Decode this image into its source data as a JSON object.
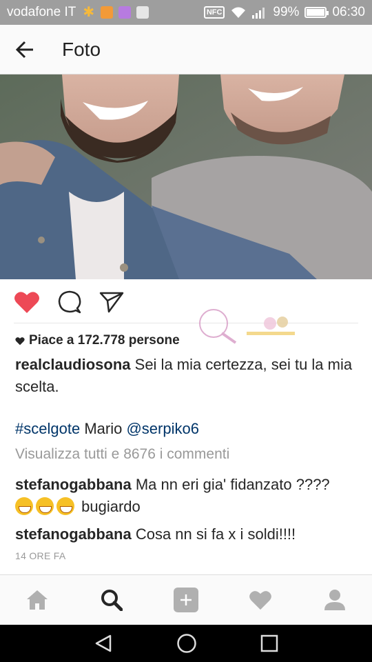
{
  "status_bar": {
    "carrier": "vodafone IT",
    "nfc": "NFC",
    "battery": "99%",
    "battery_level": 0.99,
    "time": "06:30"
  },
  "header": {
    "title": "Foto",
    "back_icon": "arrow-left-icon"
  },
  "post": {
    "likes_text": "Piace a 172.778 persone",
    "author": "realclaudiosona",
    "caption": "Sei la mia certezza, sei tu la mia scelta.",
    "hashtag": "#scelgote",
    "tag_text": "Mario",
    "mention": "@serpiko6",
    "view_all": "Visualizza tutti e 8676 i commenti",
    "comments": [
      {
        "user": "stefanogabbana",
        "text": "Ma nn eri gia'  fidanzato ????",
        "text2": "bugiardo"
      },
      {
        "user": "stefanogabbana",
        "text": "Cosa nn si fa x i soldi!!!!"
      }
    ],
    "timestamp": "14 ORE FA",
    "liked_color": "#ed4956"
  },
  "tabs": [
    "home-icon",
    "search-icon",
    "add-icon",
    "heart-icon",
    "profile-icon"
  ]
}
